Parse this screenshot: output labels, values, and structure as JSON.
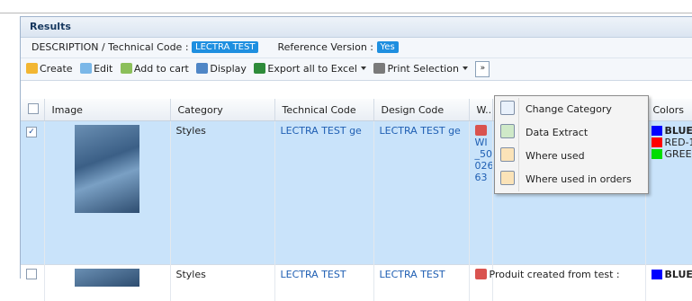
{
  "panel": {
    "title": "Results"
  },
  "info": {
    "desc_label": "DESCRIPTION / Technical Code :",
    "desc_value": "LECTRA TEST",
    "ref_label": "Reference Version :",
    "ref_value": "Yes"
  },
  "toolbar": {
    "create": "Create",
    "edit": "Edit",
    "add_to_cart": "Add to cart",
    "display": "Display",
    "export": "Export all to Excel",
    "print": "Print Selection",
    "more": "»"
  },
  "table": {
    "headers": [
      "Image",
      "Category",
      "Technical Code",
      "Design Code",
      "W..",
      "",
      "Colors"
    ],
    "rows": [
      {
        "checked": "✓",
        "category": "Styles",
        "technical_code": "LECTRA TEST ge",
        "design_code": "LECTRA TEST ge",
        "w_lines": [
          "WI",
          "_50",
          "026",
          "63"
        ],
        "colors": [
          {
            "name": "BLUE-",
            "hex": "#0000ff"
          },
          {
            "name": "RED-1",
            "hex": "#ff0000"
          },
          {
            "name": "GREEN",
            "hex": "#00dd00"
          }
        ]
      },
      {
        "checked": "",
        "category": "Styles",
        "technical_code": "LECTRA TEST",
        "design_code": "LECTRA TEST",
        "note": "Produit created from test :",
        "colors": [
          {
            "name": "BLUE-",
            "hex": "#0000ff"
          }
        ]
      }
    ]
  },
  "context_menu": {
    "items": [
      "Change Category",
      "Data Extract",
      "Where used",
      "Where used in orders"
    ]
  }
}
